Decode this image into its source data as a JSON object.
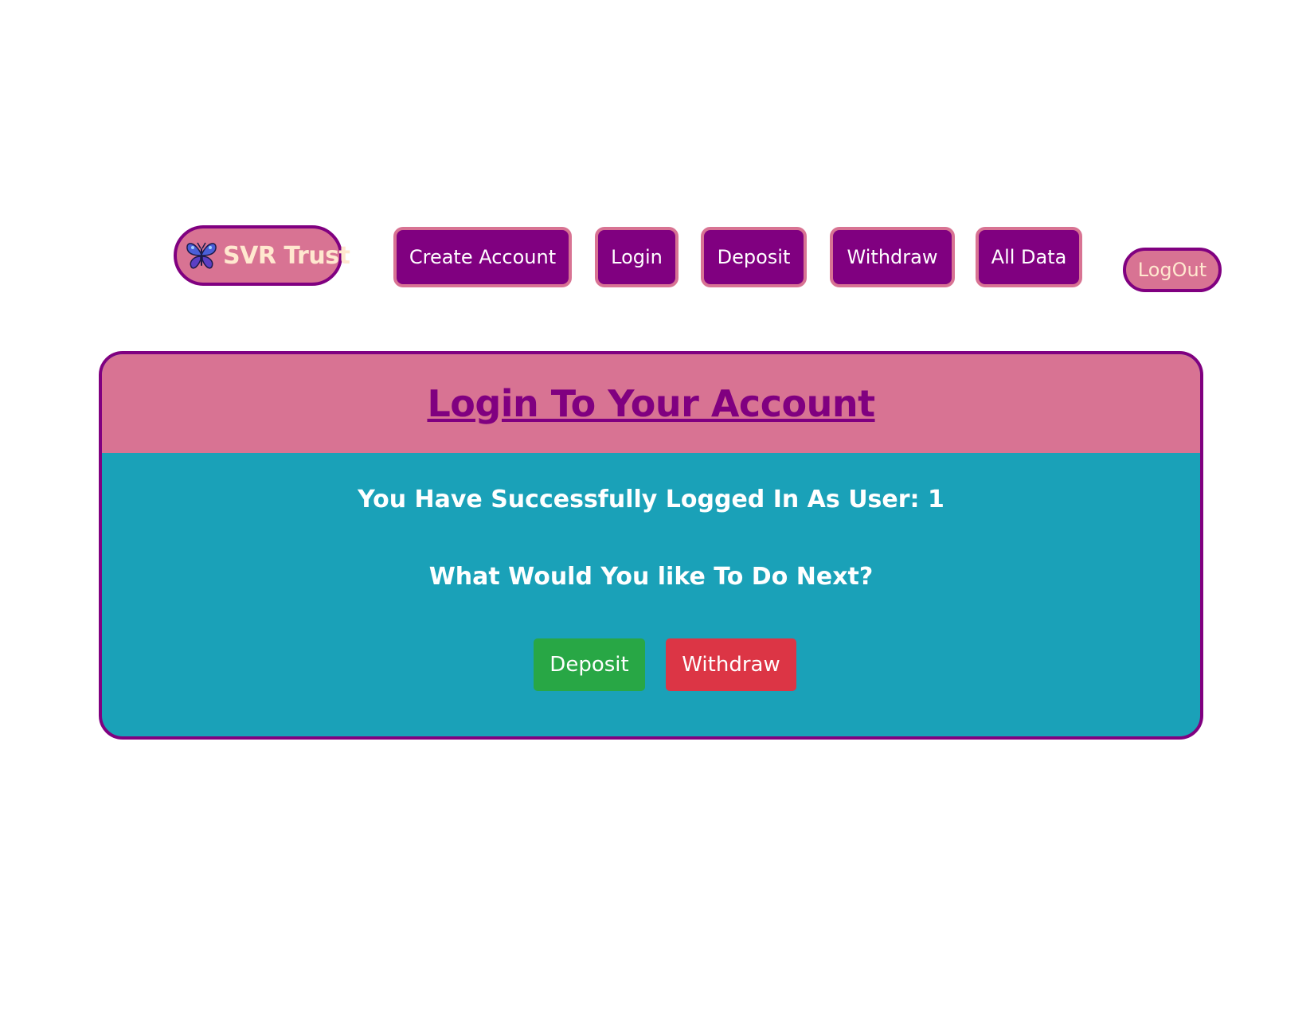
{
  "navbar": {
    "brand": {
      "label": "SVR Trust",
      "icon": "butterfly-icon"
    },
    "items": [
      {
        "label": "Create Account"
      },
      {
        "label": "Login"
      },
      {
        "label": "Deposit"
      },
      {
        "label": "Withdraw"
      },
      {
        "label": "All Data"
      }
    ],
    "logout_label": "LogOut"
  },
  "card": {
    "title": "Login To Your Account",
    "success_message": "You Have Successfully Logged In As User: 1",
    "prompt": "What Would You like To Do Next?",
    "deposit_label": "Deposit",
    "withdraw_label": "Withdraw"
  },
  "colors": {
    "purple": "#800080",
    "pink": "#d87393",
    "teal": "#1aa1b8",
    "cream": "#ffe8cf",
    "success": "#28a745",
    "danger": "#dc3545"
  }
}
